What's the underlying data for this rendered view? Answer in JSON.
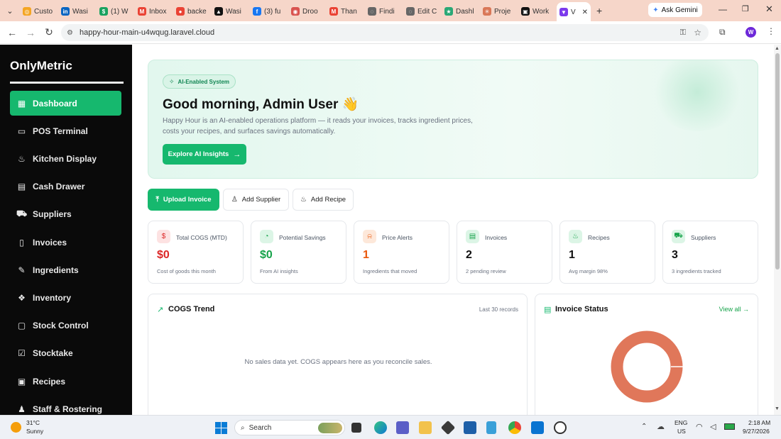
{
  "browser": {
    "tabs": [
      {
        "label": "Custo",
        "color": "#f4a523",
        "glyph": "◎"
      },
      {
        "label": "Wasi",
        "color": "#0a66c2",
        "glyph": "in"
      },
      {
        "label": "(1) W",
        "color": "#1aa260",
        "glyph": "$"
      },
      {
        "label": "Inbox",
        "color": "#ea4335",
        "glyph": "M"
      },
      {
        "label": "backe",
        "color": "#ea4335",
        "glyph": "●"
      },
      {
        "label": "Wasi",
        "color": "#111111",
        "glyph": "▲"
      },
      {
        "label": "(3) fu",
        "color": "#1877f2",
        "glyph": "f"
      },
      {
        "label": "Droo",
        "color": "#d9534f",
        "glyph": "◉"
      },
      {
        "label": "Than",
        "color": "#ea4335",
        "glyph": "M"
      },
      {
        "label": "Findi",
        "color": "#666666",
        "glyph": "◌"
      },
      {
        "label": "Edit C",
        "color": "#666666",
        "glyph": "◌"
      },
      {
        "label": "Dashl",
        "color": "#2aa876",
        "glyph": "★"
      },
      {
        "label": "Proje",
        "color": "#d97757",
        "glyph": "✳"
      },
      {
        "label": "Work",
        "color": "#111111",
        "glyph": "▣"
      },
      {
        "label": "V",
        "color": "#7c3aed",
        "glyph": "▼"
      }
    ],
    "ask_gemini": "Ask Gemini",
    "url": "happy-hour-main-u4wqug.laravel.cloud",
    "profile_initial": "W"
  },
  "sidebar": {
    "brand": "OnlyMetric",
    "items": [
      {
        "label": "Dashboard",
        "icon": "grid-icon",
        "glyph": "▦"
      },
      {
        "label": "POS Terminal",
        "icon": "monitor-icon",
        "glyph": "▭"
      },
      {
        "label": "Kitchen Display",
        "icon": "chef-hat-icon",
        "glyph": "♨"
      },
      {
        "label": "Cash Drawer",
        "icon": "drawer-icon",
        "glyph": "▤"
      },
      {
        "label": "Suppliers",
        "icon": "truck-icon",
        "glyph": "⛟"
      },
      {
        "label": "Invoices",
        "icon": "file-icon",
        "glyph": "▯"
      },
      {
        "label": "Ingredients",
        "icon": "flask-icon",
        "glyph": "✎"
      },
      {
        "label": "Inventory",
        "icon": "boxes-icon",
        "glyph": "❖"
      },
      {
        "label": "Stock Control",
        "icon": "clipboard-icon",
        "glyph": "▢"
      },
      {
        "label": "Stocktake",
        "icon": "checklist-icon",
        "glyph": "☑"
      },
      {
        "label": "Recipes",
        "icon": "book-icon",
        "glyph": "▣"
      },
      {
        "label": "Staff & Rostering",
        "icon": "users-icon",
        "glyph": "♟"
      }
    ]
  },
  "hero": {
    "chip": "AI-Enabled System",
    "title": "Good morning, Admin User 👋",
    "description": "Happy Hour is an AI-enabled operations platform — it reads your invoices, tracks ingredient prices, costs your recipes, and surfaces savings automatically.",
    "button": "Explore AI Insights"
  },
  "actions": {
    "upload": "Upload Invoice",
    "supplier": "Add Supplier",
    "recipe": "Add Recipe"
  },
  "stats": [
    {
      "label": "Total COGS (MTD)",
      "value": "$0",
      "sub": "Cost of goods this month",
      "color": "#dc2626",
      "bg": "#fde2e2",
      "icon": "dollar-icon",
      "glyph": "$"
    },
    {
      "label": "Potential Savings",
      "value": "$0",
      "sub": "From AI insights",
      "color": "#16a34a",
      "bg": "#dcf5e6",
      "icon": "piggy-bank-icon",
      "glyph": "◔"
    },
    {
      "label": "Price Alerts",
      "value": "1",
      "sub": "Ingredients that moved",
      "color": "#ea580c",
      "bg": "#fde8da",
      "icon": "bell-icon",
      "glyph": "⍾"
    },
    {
      "label": "Invoices",
      "value": "2",
      "sub": "2 pending review",
      "color": "#111111",
      "bg": "#dcf5e6",
      "icon": "file-text-icon",
      "glyph": "▤"
    },
    {
      "label": "Recipes",
      "value": "1",
      "sub": "Avg margin 98%",
      "color": "#111111",
      "bg": "#dcf5e6",
      "icon": "chef-hat-icon",
      "glyph": "♨"
    },
    {
      "label": "Suppliers",
      "value": "3",
      "sub": "3 ingredients tracked",
      "color": "#111111",
      "bg": "#dcf5e6",
      "icon": "truck-icon",
      "glyph": "⛟"
    }
  ],
  "cogs_trend": {
    "title": "COGS Trend",
    "meta": "Last 30 records",
    "empty": "No sales data yet. COGS appears here as you reconcile sales."
  },
  "invoice_status": {
    "title": "Invoice Status",
    "link": "View all →",
    "ring_color": "#e0775a"
  },
  "taskbar": {
    "temp": "31°C",
    "weather": "Sunny",
    "search": "Search",
    "lang1": "ENG",
    "lang2": "US",
    "time": "2:18 AM",
    "date": "9/27/2026"
  }
}
